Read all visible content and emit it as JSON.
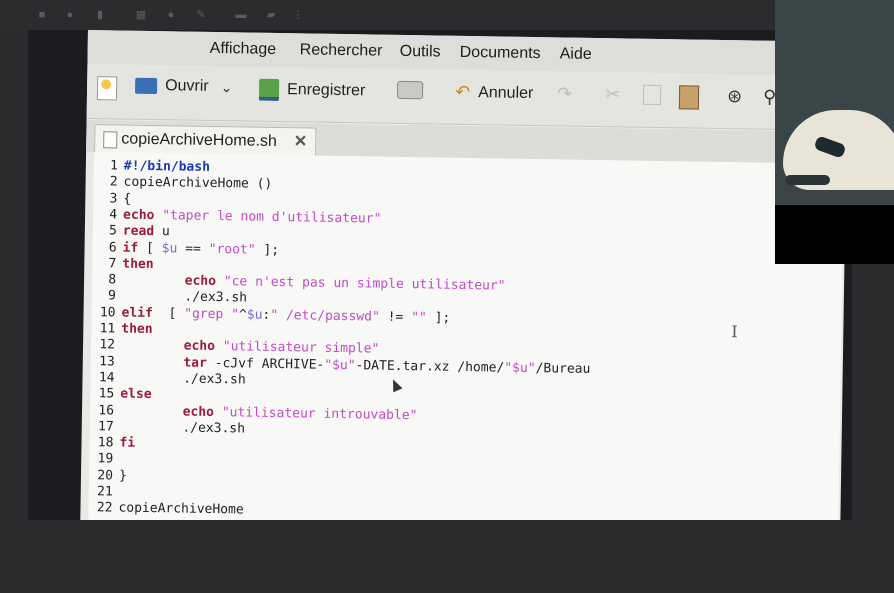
{
  "menubar": {
    "items": [
      "Affichage",
      "Rechercher",
      "Outils",
      "Documents",
      "Aide"
    ]
  },
  "toolbar": {
    "open_label": "Ouvrir",
    "save_label": "Enregistrer",
    "undo_label": "Annuler"
  },
  "tab": {
    "filename": "copieArchiveHome.sh"
  },
  "editor": {
    "lines": [
      {
        "n": "1",
        "text": "#!/bin/bash"
      },
      {
        "n": "2",
        "text": "copieArchiveHome ()"
      },
      {
        "n": "3",
        "text": "{"
      },
      {
        "n": "4",
        "text": "echo \"taper le nom d'utilisateur\""
      },
      {
        "n": "5",
        "text": "read u"
      },
      {
        "n": "6",
        "text": "if [ $u == \"root\" ];"
      },
      {
        "n": "7",
        "text": "then"
      },
      {
        "n": "8",
        "text": "        echo \"ce n'est pas un simple utilisateur\""
      },
      {
        "n": "9",
        "text": "        ./ex3.sh"
      },
      {
        "n": "10",
        "text": "elif  [ \"grep \"^$u:\" /etc/passwd\" != \"\" ];"
      },
      {
        "n": "11",
        "text": "then"
      },
      {
        "n": "12",
        "text": "        echo \"utilisateur simple\""
      },
      {
        "n": "13",
        "text": "        tar -cJvf ARCHIVE-\"$u\"-DATE.tar.xz /home/\"$u\"/Bureau"
      },
      {
        "n": "14",
        "text": "        ./ex3.sh"
      },
      {
        "n": "15",
        "text": "else"
      },
      {
        "n": "16",
        "text": "        echo \"utilisateur introuvable\""
      },
      {
        "n": "17",
        "text": "        ./ex3.sh"
      },
      {
        "n": "18",
        "text": "fi"
      },
      {
        "n": "19",
        "text": ""
      },
      {
        "n": "20",
        "text": "}"
      },
      {
        "n": "21",
        "text": ""
      },
      {
        "n": "22",
        "text": "copieArchiveHome"
      }
    ]
  },
  "icons": {
    "new": "new-document-icon",
    "open": "folder-open-icon",
    "save": "save-icon",
    "print": "print-icon",
    "undo": "undo-icon",
    "search": "binoculars-icon",
    "paste": "paste-icon"
  }
}
